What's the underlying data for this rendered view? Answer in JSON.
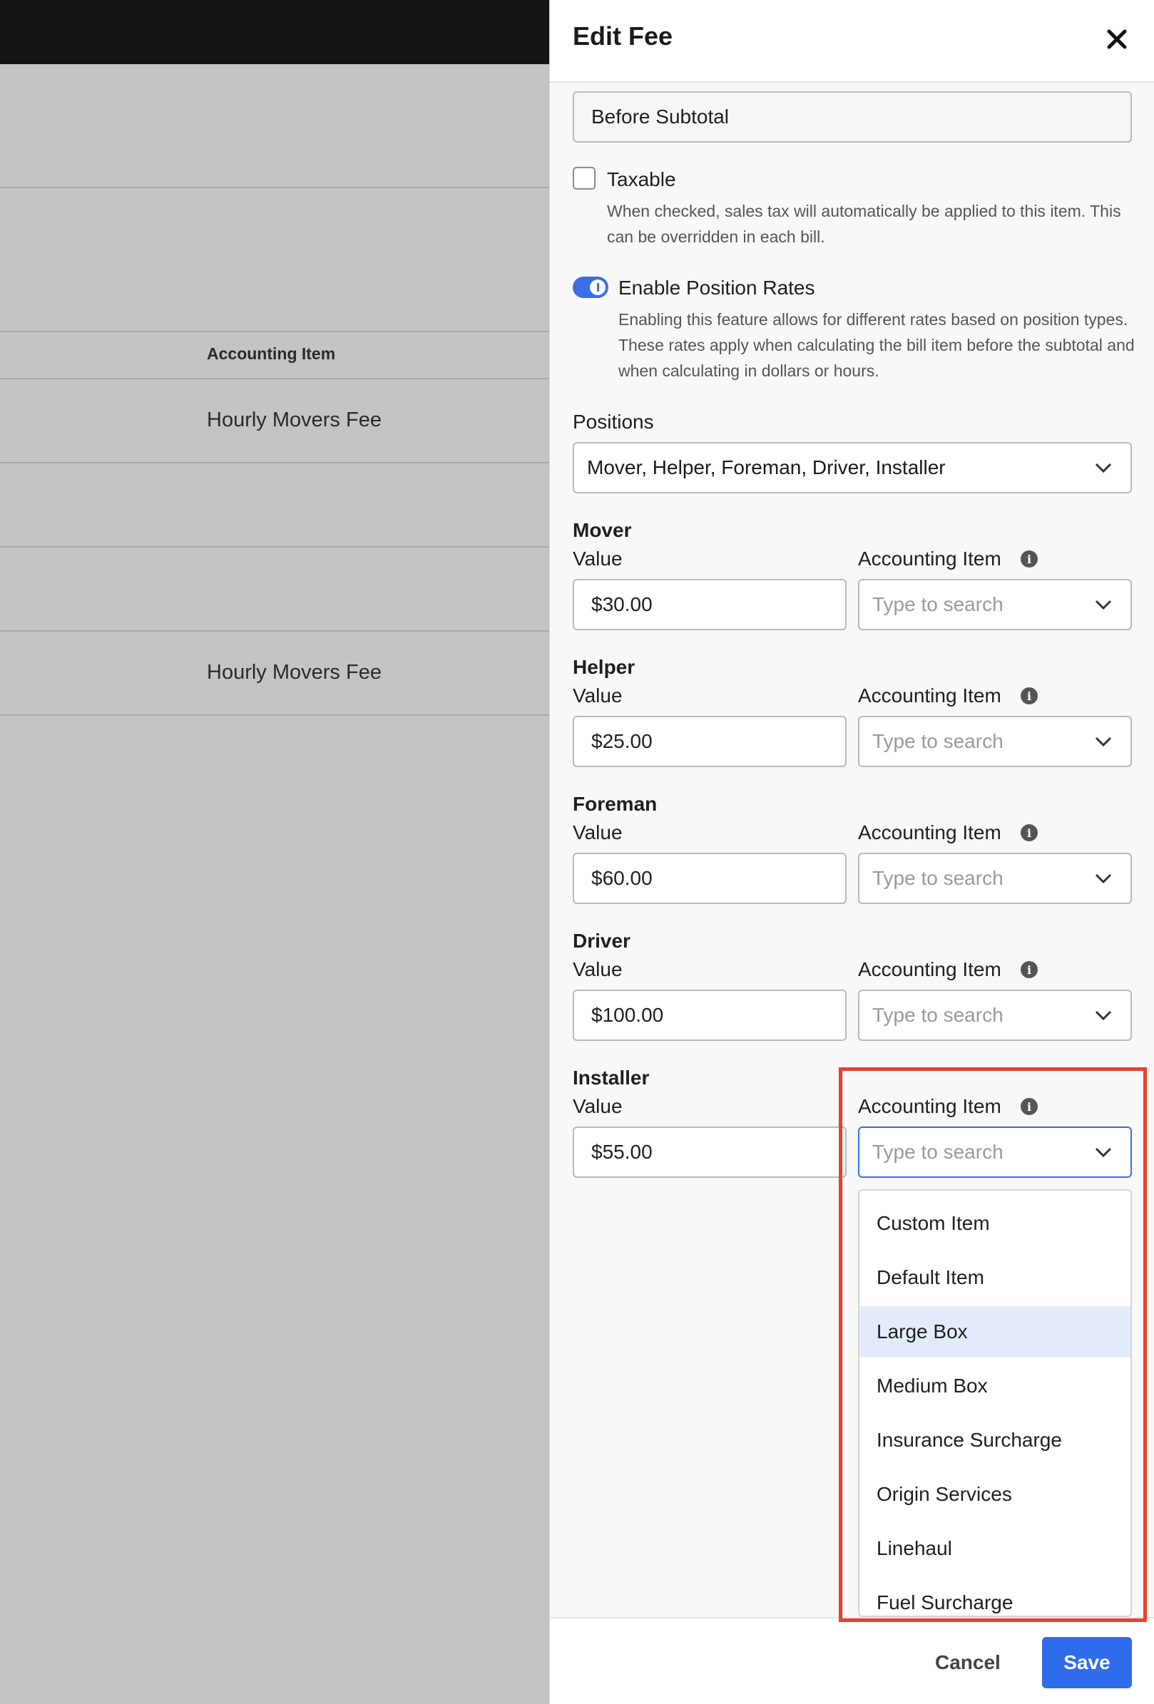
{
  "background": {
    "table_header": "Accounting Item",
    "rows": [
      "Hourly Movers Fee",
      "Hourly Movers Fee"
    ]
  },
  "drawer": {
    "title": "Edit Fee",
    "close_icon": "close-icon",
    "calculation_value": "Before Subtotal",
    "taxable": {
      "label": "Taxable",
      "checked": false,
      "help": "When checked, sales tax will automatically be applied to this item. This can be overridden in each bill."
    },
    "position_rates": {
      "label": "Enable Position Rates",
      "enabled": true,
      "help": "Enabling this feature allows for different rates based on position types. These rates apply when calculating the bill item before the subtotal and when calculating in dollars or hours."
    },
    "positions_label": "Positions",
    "positions_value": "Mover, Helper, Foreman, Driver, Installer",
    "value_label": "Value",
    "accounting_label": "Accounting Item",
    "accounting_placeholder": "Type to search",
    "rates": [
      {
        "position": "Mover",
        "value": "$30.00"
      },
      {
        "position": "Helper",
        "value": "$25.00"
      },
      {
        "position": "Foreman",
        "value": "$60.00"
      },
      {
        "position": "Driver",
        "value": "$100.00"
      },
      {
        "position": "Installer",
        "value": "$55.00"
      }
    ],
    "dropdown_options": [
      "Custom Item",
      "Default Item",
      "Large Box",
      "Medium Box",
      "Insurance Surcharge",
      "Origin Services",
      "Linehaul",
      "Fuel Surcharge"
    ],
    "highlighted_option": "Large Box",
    "accent_color": "#2f6cec",
    "highlight_color": "#e8412e",
    "cancel_label": "Cancel",
    "save_label": "Save"
  }
}
